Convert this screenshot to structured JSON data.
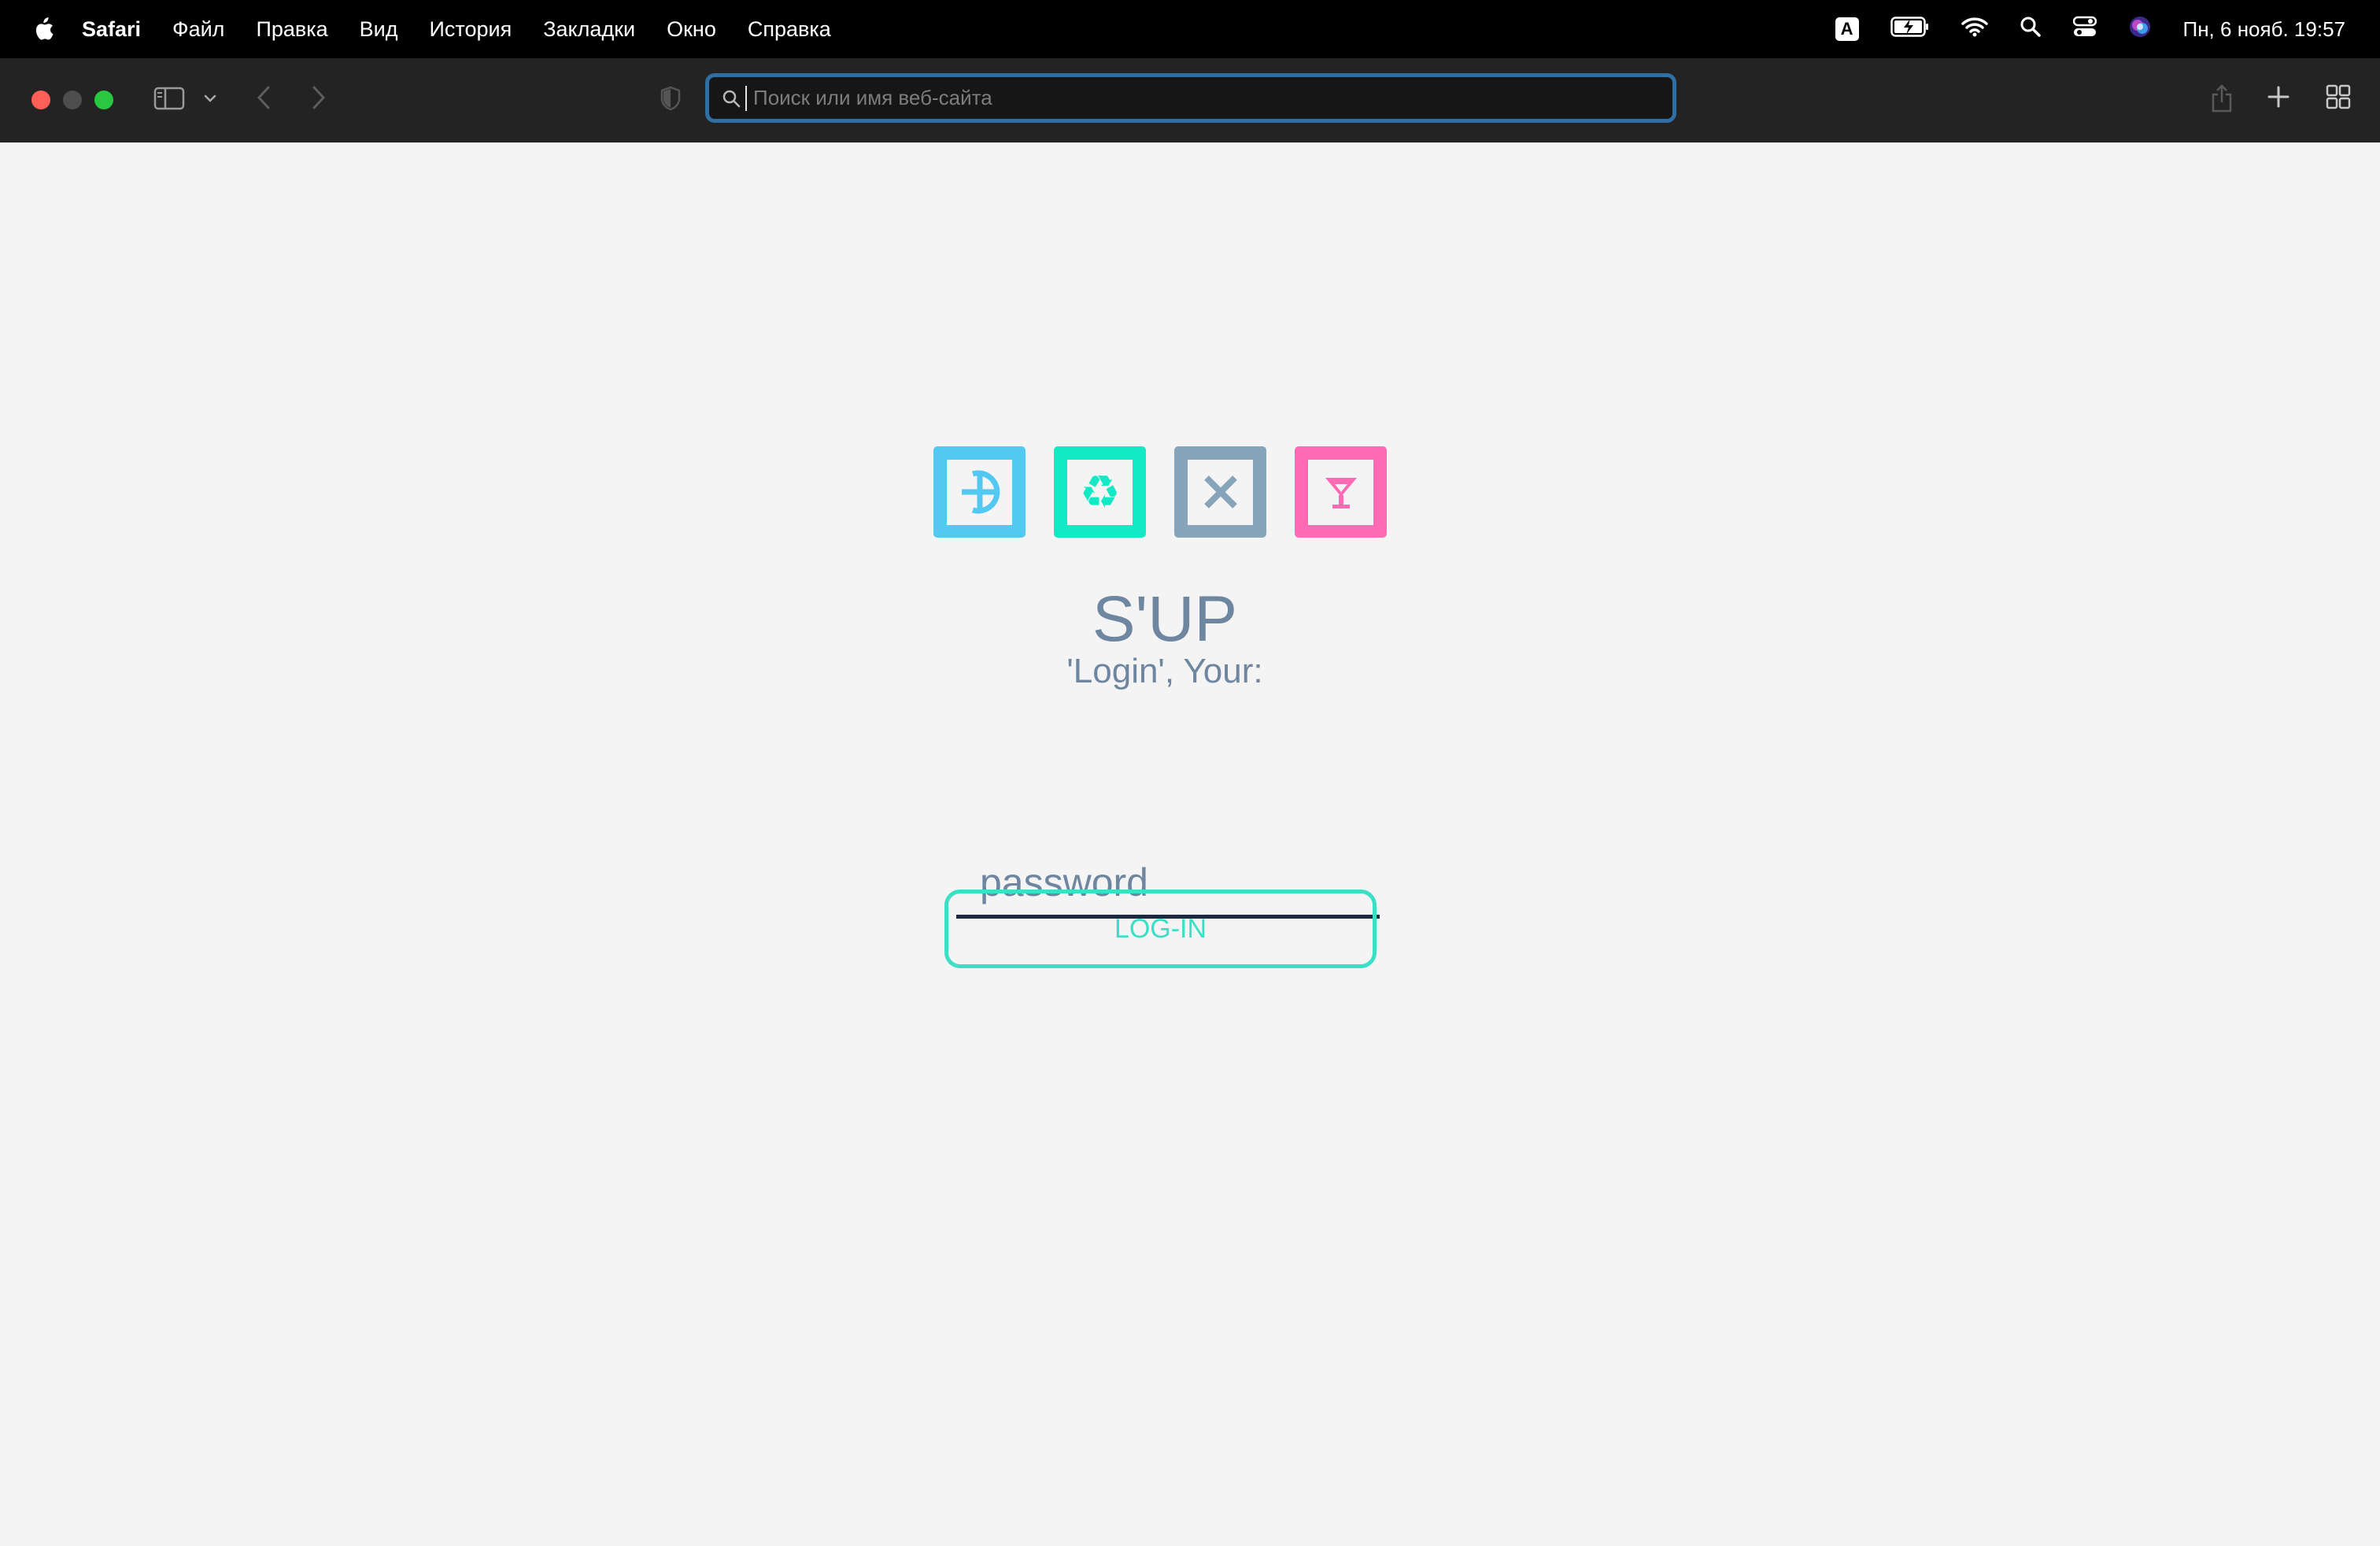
{
  "menubar": {
    "app_name": "Safari",
    "items": [
      "Файл",
      "Правка",
      "Вид",
      "История",
      "Закладки",
      "Окно",
      "Справка"
    ],
    "input_indicator": "A",
    "clock": "Пн, 6 нояб.  19:57"
  },
  "toolbar": {
    "address_placeholder": "Поиск или имя веб-сайта",
    "address_value": ""
  },
  "page": {
    "logos": [
      {
        "name": "compass-logo",
        "color": "#52c9f2"
      },
      {
        "name": "recycle-logo",
        "color": "#13e9c4"
      },
      {
        "name": "cross-logo",
        "color": "#87a5ba"
      },
      {
        "name": "cocktail-logo",
        "color": "#ff6ab4"
      }
    ],
    "title": "S'UP",
    "subtitle": "'Login', Your:",
    "password_placeholder": "password",
    "login_button": "LOG-IN"
  }
}
